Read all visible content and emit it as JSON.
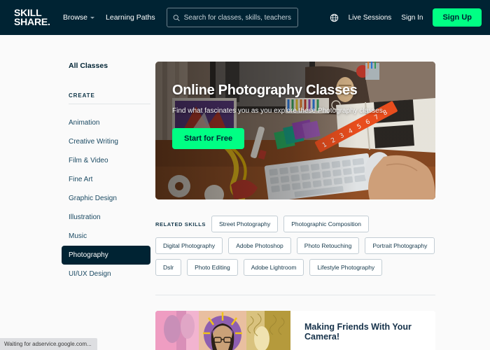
{
  "header": {
    "logo_line1": "SKILL",
    "logo_line2": "SHARE.",
    "nav": [
      {
        "label": "Browse",
        "has_chevron": true
      },
      {
        "label": "Learning Paths",
        "has_chevron": false
      }
    ],
    "search_placeholder": "Search for classes, skills, teachers",
    "search_value": "",
    "live_sessions_label": "Live Sessions",
    "sign_in_label": "Sign In",
    "sign_up_label": "Sign Up",
    "bg_color": "#002333",
    "accent_color": "#00FF84"
  },
  "sidebar": {
    "all_classes_label": "All Classes",
    "section_heading": "CREATE",
    "items": [
      {
        "label": "Animation",
        "active": false
      },
      {
        "label": "Creative Writing",
        "active": false
      },
      {
        "label": "Film & Video",
        "active": false
      },
      {
        "label": "Fine Art",
        "active": false
      },
      {
        "label": "Graphic Design",
        "active": false
      },
      {
        "label": "Illustration",
        "active": false
      },
      {
        "label": "Music",
        "active": false
      },
      {
        "label": "Photography",
        "active": true
      },
      {
        "label": "UI/UX Design",
        "active": false
      }
    ]
  },
  "hero": {
    "title": "Online Photography Classes",
    "subtitle": "Find what fascinates you as you explore these Photography classes.",
    "cta_label": "Start for Free"
  },
  "related_skills": {
    "label": "RELATED SKILLS",
    "tags": [
      "Street Photography",
      "Photographic Composition",
      "Digital Photography",
      "Adobe Photoshop",
      "Photo Retouching",
      "Portrait Photography",
      "Dslr",
      "Photo Editing",
      "Adobe Lightroom",
      "Lifestyle Photography"
    ]
  },
  "class_card": {
    "title": "Making Friends With Your Camera!"
  },
  "statusbar": {
    "text": "Waiting for adservice.google.com..."
  }
}
